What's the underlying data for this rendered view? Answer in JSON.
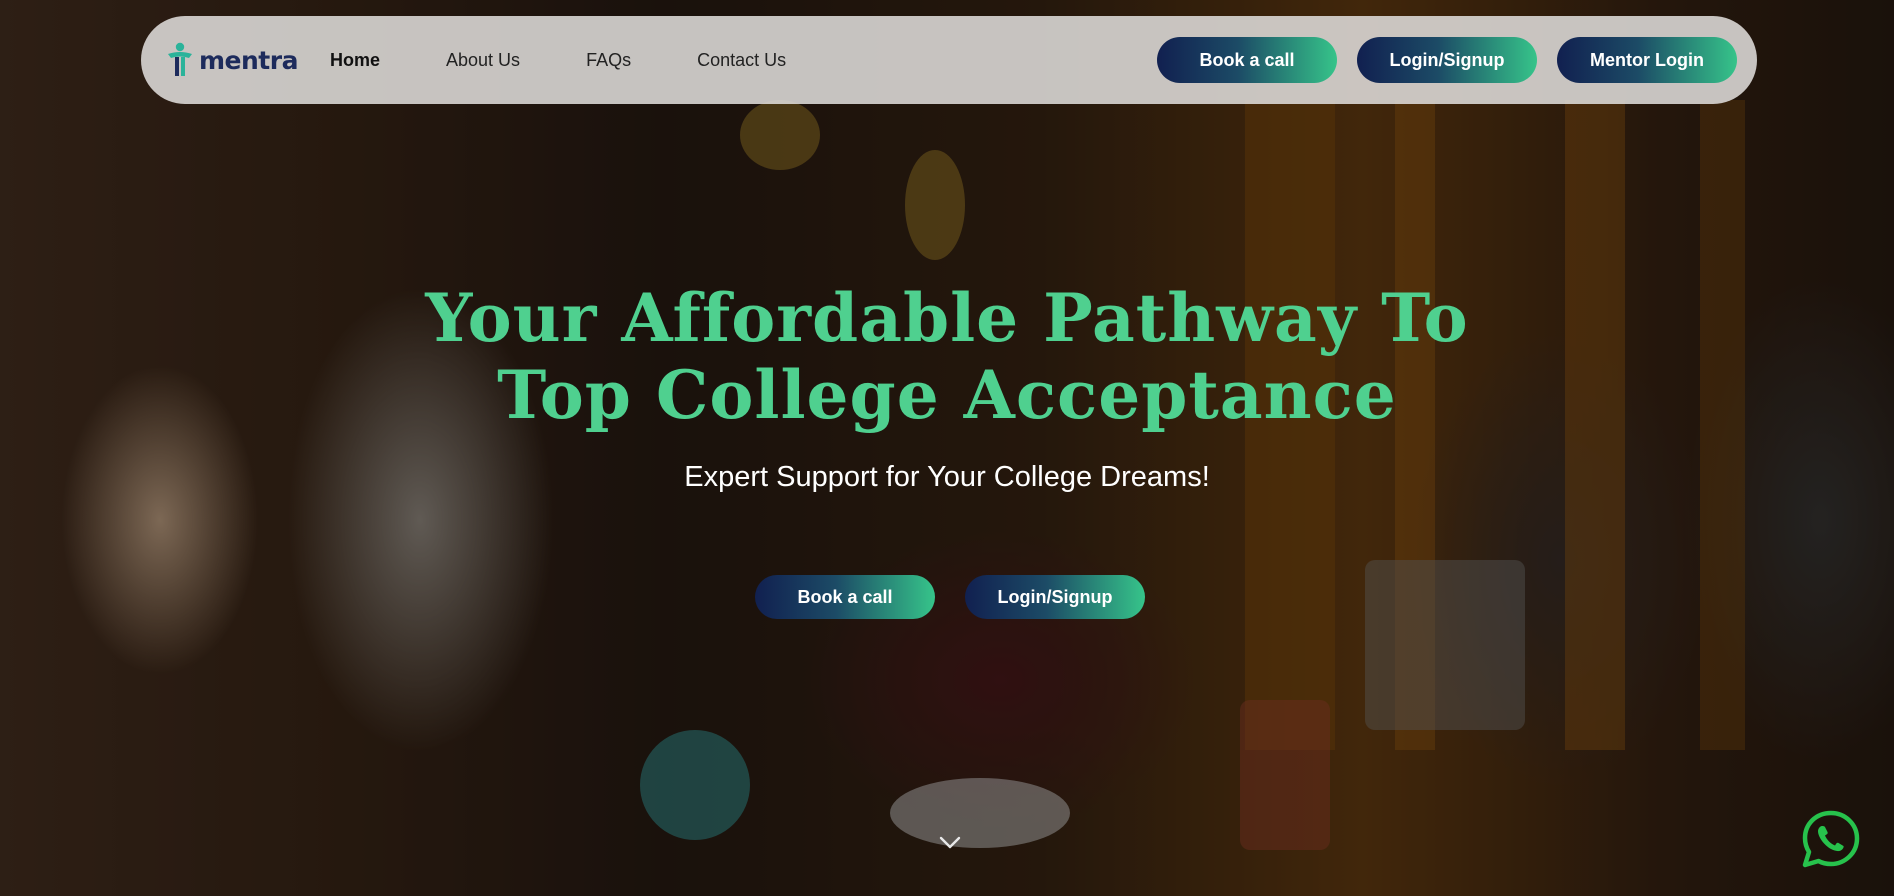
{
  "brand": {
    "name": "mentra"
  },
  "nav": {
    "links": [
      {
        "label": "Home",
        "active": true
      },
      {
        "label": "About Us"
      },
      {
        "label": "FAQs"
      },
      {
        "label": "Contact Us"
      }
    ],
    "buttons": {
      "book": "Book a call",
      "login": "Login/Signup",
      "mentor": "Mentor Login"
    }
  },
  "hero": {
    "title_line1": "Your Affordable Pathway To",
    "title_line2": "Top College Acceptance",
    "subtitle": "Expert Support for Your College Dreams!",
    "buttons": {
      "book": "Book a call",
      "login": "Login/Signup"
    }
  },
  "icons": {
    "logo": "mentra-logo-icon",
    "scroll": "chevron-down-icon",
    "chat": "whatsapp-icon"
  },
  "colors": {
    "accent_green": "#4fd08f",
    "navy": "#112050",
    "nav_bg": "#dedcda"
  }
}
